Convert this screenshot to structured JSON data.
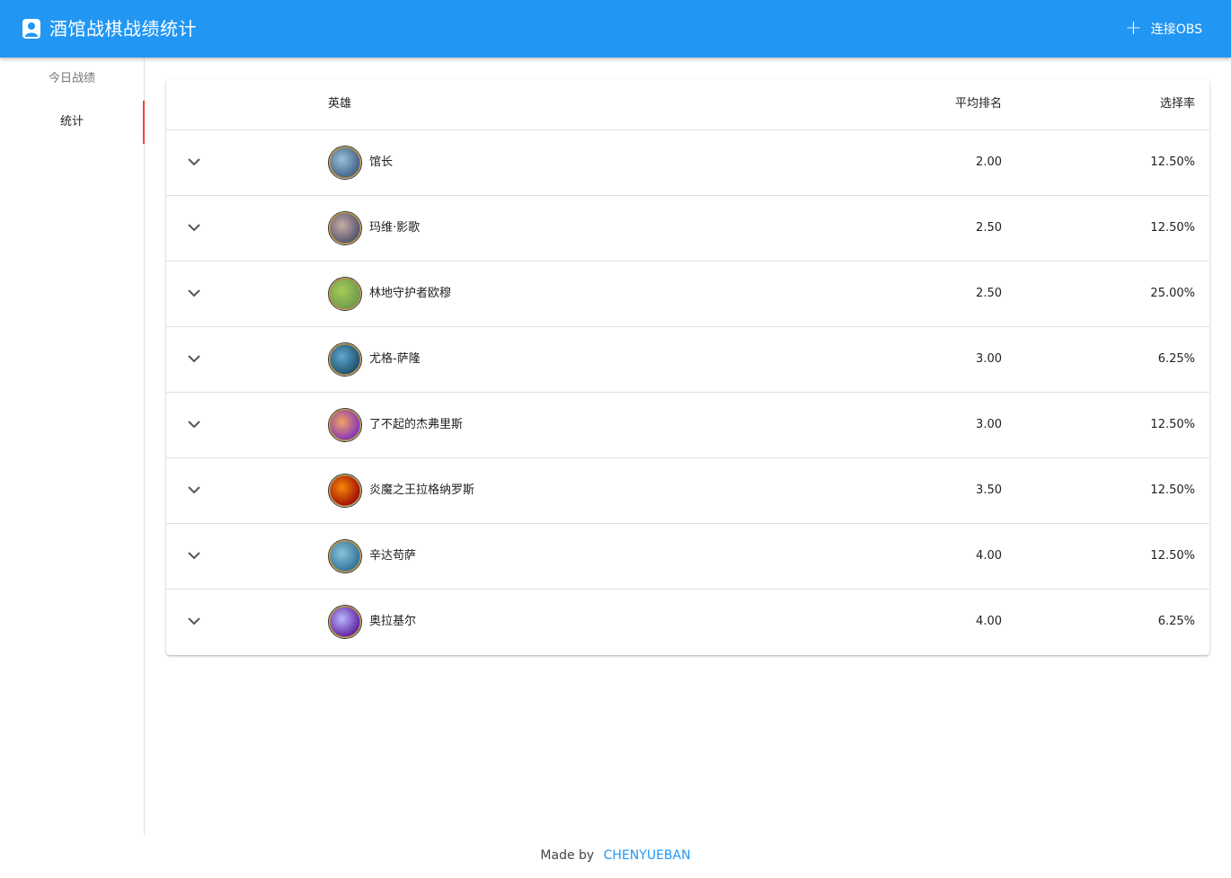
{
  "app": {
    "title": "酒馆战棋战绩统计",
    "connect_obs_label": "连接OBS",
    "accent_color": "#2196f3",
    "active_tab_color": "#f44336"
  },
  "sidebar": {
    "items": [
      {
        "label": "今日战绩",
        "active": false
      },
      {
        "label": "统计",
        "active": true
      }
    ]
  },
  "table": {
    "headers": {
      "hero": "英雄",
      "avg_rank": "平均排名",
      "pick_rate": "选择率"
    },
    "rows": [
      {
        "hero": "馆长",
        "avg_rank": "2.00",
        "pick_rate": "12.50%",
        "avatar_icon": "hero-portrait-icon"
      },
      {
        "hero": "玛维·影歌",
        "avg_rank": "2.50",
        "pick_rate": "12.50%",
        "avatar_icon": "hero-portrait-icon"
      },
      {
        "hero": "林地守护者欧穆",
        "avg_rank": "2.50",
        "pick_rate": "25.00%",
        "avatar_icon": "hero-portrait-icon"
      },
      {
        "hero": "尤格-萨隆",
        "avg_rank": "3.00",
        "pick_rate": "6.25%",
        "avatar_icon": "hero-portrait-icon"
      },
      {
        "hero": "了不起的杰弗里斯",
        "avg_rank": "3.00",
        "pick_rate": "12.50%",
        "avatar_icon": "hero-portrait-icon"
      },
      {
        "hero": "炎魔之王拉格纳罗斯",
        "avg_rank": "3.50",
        "pick_rate": "12.50%",
        "avatar_icon": "hero-portrait-icon"
      },
      {
        "hero": "辛达苟萨",
        "avg_rank": "4.00",
        "pick_rate": "12.50%",
        "avatar_icon": "hero-portrait-icon"
      },
      {
        "hero": "奥拉基尔",
        "avg_rank": "4.00",
        "pick_rate": "6.25%",
        "avatar_icon": "hero-portrait-icon"
      }
    ]
  },
  "footer": {
    "made_by": "Made by",
    "author": "CHENYUEBAN"
  }
}
